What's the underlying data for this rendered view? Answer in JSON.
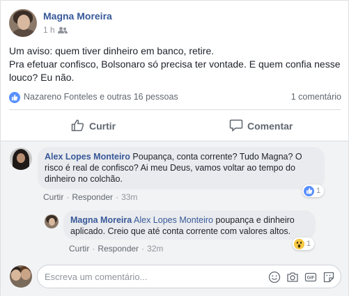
{
  "post": {
    "author": "Magna Moreira",
    "time": "1 h",
    "audience_icon": "friends-icon",
    "text_lines": [
      "Um aviso: quem tiver dinheiro em banco, retire.",
      "Pra efetuar confisco, Bolsonaro só precisa ter vontade. E quem confia nesse",
      "louco? Eu não."
    ],
    "reactors": "Nazareno Fonteles e outras 16 pessoas",
    "comment_count": "1 comentário"
  },
  "actions": {
    "like_label": "Curtir",
    "comment_label": "Comentar"
  },
  "comments": [
    {
      "author": "Alex Lopes Monteiro",
      "text_lines": [
        "Poupança, conta corrente? Tudo Magna? O",
        "risco é real de confisco? Ai meu Deus, vamos voltar ao tempo do",
        "dinheiro no colchão."
      ],
      "like_label": "Curtir",
      "reply_label": "Responder",
      "time": "33m",
      "reaction_count": "1",
      "reaction": "like"
    },
    {
      "author": "Magna Moreira",
      "tag": "Alex Lopes Monteiro",
      "text_lines": [
        "poupança e dinheiro",
        "aplicado. Creio que até conta corrente com valores altos."
      ],
      "like_label": "Curtir",
      "reply_label": "Responder",
      "time": "32m",
      "reaction_count": "1",
      "reaction": "wow"
    }
  ],
  "composer": {
    "placeholder": "Escreva um comentário..."
  },
  "colors": {
    "link_blue": "#385898",
    "like_blue": "#5890ff",
    "muted": "#90949c"
  }
}
